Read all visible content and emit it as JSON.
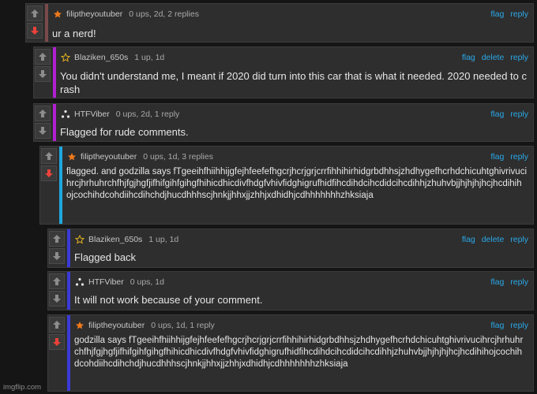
{
  "comments": [
    {
      "username": "filiptheyoutuber",
      "meta": "0 ups, 2d, 2 replies",
      "actions": [
        "flag",
        "reply"
      ],
      "text": "ur a nerd!",
      "bar_color": "#7a4a4a",
      "star": "orange-star-icon",
      "down_active": true
    },
    {
      "username": "Blaziken_650s",
      "meta": "1 up, 1d",
      "actions": [
        "flag",
        "delete",
        "reply"
      ],
      "text": "You didn't understand me, I meant if 2020 did turn into this car that is what it needed. 2020 needed to crash",
      "bar_color": "#b11fd1",
      "star": "gold-star-outline-icon",
      "down_active": false
    },
    {
      "username": "HTFViber",
      "meta": "0 ups, 2d, 1 reply",
      "actions": [
        "flag",
        "reply"
      ],
      "text": "Flagged for rude comments.",
      "bar_color": "#b11fd1",
      "star": "tri-dots-icon",
      "down_active": false
    },
    {
      "username": "filiptheyoutuber",
      "meta": "0 ups, 1d, 3 replies",
      "actions": [
        "flag",
        "reply"
      ],
      "text": "flagged. and godzilla says fTgeeihfhiihhijgfejhfeefefhgcrjhcrjgrjcrrfihhihirhidgrbdhhsjzhdhygefhcrhdchicuhtghivrivucihrcjhrhuhrchfhjfgjhgfjifhifgihfgihgfhihicdhicdivfhdgfvhivfidghigrufhidfihcdihdcihcdidcihcdihhjzhuhvbjjhjhjhjhcjhcdihihojcochihdcohdiihcdihchdjhucdhhhscjhnkjjhhxjjzhhjxdhidhjcdhhhhhhhzhksiaja",
      "bar_color": "#1fa8e0",
      "star": "orange-star-icon",
      "down_active": true
    },
    {
      "username": "Blaziken_650s",
      "meta": "1 up, 1d",
      "actions": [
        "flag",
        "delete",
        "reply"
      ],
      "text": "Flagged back",
      "bar_color": "#3a3ad8",
      "star": "gold-star-outline-icon",
      "down_active": false
    },
    {
      "username": "HTFViber",
      "meta": "0 ups, 1d",
      "actions": [
        "flag",
        "reply"
      ],
      "text": "It will not work because of your comment.",
      "bar_color": "#3a3ad8",
      "star": "tri-dots-icon",
      "down_active": false
    },
    {
      "username": "filiptheyoutuber",
      "meta": "0 ups, 1d, 1 reply",
      "actions": [
        "flag",
        "reply"
      ],
      "text": "godzilla says fTgeeihfhiihhijgfejhfeefefhgcrjhcrjgrjcrrfihhihirhidgrbdhhsjzhdhygefhcrhdchicuhtghivrivucihrcjhrhuhrchfhjfgjhgfjifhifgihfgihgfhihicdhicdivfhdgfvhivfidghigrufhidfihcdihdcihcdidcihcdihhjzhuhvbjjhjhjhjhcjhcdihihojcochihdcohdiihcdihchdjhucdhhhscjhnkjjhhxjjzhhjxdhidhjcdhhhhhhhzhksiaja",
      "bar_color": "#3a3ad8",
      "star": "orange-star-icon",
      "down_active": true
    }
  ],
  "watermark": "imgflip.com",
  "colors": {
    "accent_link": "#2aa8e8",
    "downvote_active": "#e8423a"
  }
}
